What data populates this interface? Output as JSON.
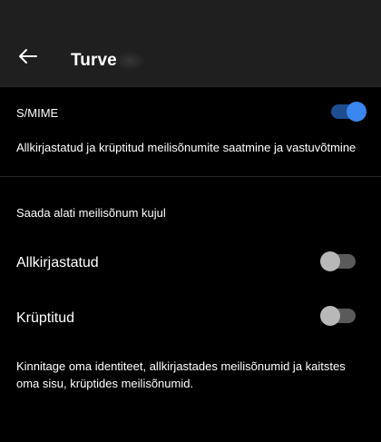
{
  "header": {
    "title": "Turve",
    "back_icon": "arrow-left-icon"
  },
  "smime": {
    "label": "S/MIME",
    "enabled": true,
    "description": "Allkirjastatud ja krüptitud meilisõnumite saatmine ja vastuvõtmine"
  },
  "always_send": {
    "section_label": "Saada alati meilisõnum kujul",
    "signed": {
      "label": "Allkirjastatud",
      "enabled": false
    },
    "encrypted": {
      "label": "Krüptitud",
      "enabled": false
    },
    "info": "Kinnitage oma identiteet, allkirjastades meilisõnumid ja kaitstes oma sisu, krüptides meilisõnumid."
  },
  "colors": {
    "background": "#000000",
    "header": "#1f1f1f",
    "accent": "#3a86ef",
    "toggle_off_track": "#5a5a5a",
    "toggle_off_knob": "#b8b8b8"
  }
}
